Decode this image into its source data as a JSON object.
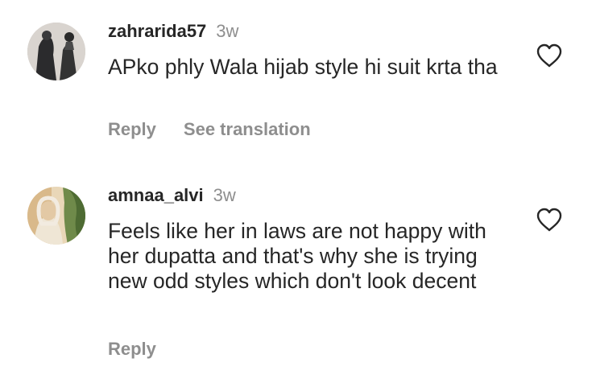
{
  "comments": [
    {
      "username": "zahrarida57",
      "time": "3w",
      "text": "APko phly Wala hijab style hi suit krta tha",
      "actions": [
        "Reply",
        "See translation"
      ]
    },
    {
      "username": "amnaa_alvi",
      "time": "3w",
      "text": "Feels like her in laws are not happy with her dupatta and that's why she is trying new odd styles which don't look decent",
      "actions": [
        "Reply"
      ]
    }
  ],
  "icons": {
    "like": "heart-outline-icon"
  },
  "colors": {
    "text": "#262626",
    "secondary": "#8e8e8e",
    "background": "#ffffff"
  }
}
